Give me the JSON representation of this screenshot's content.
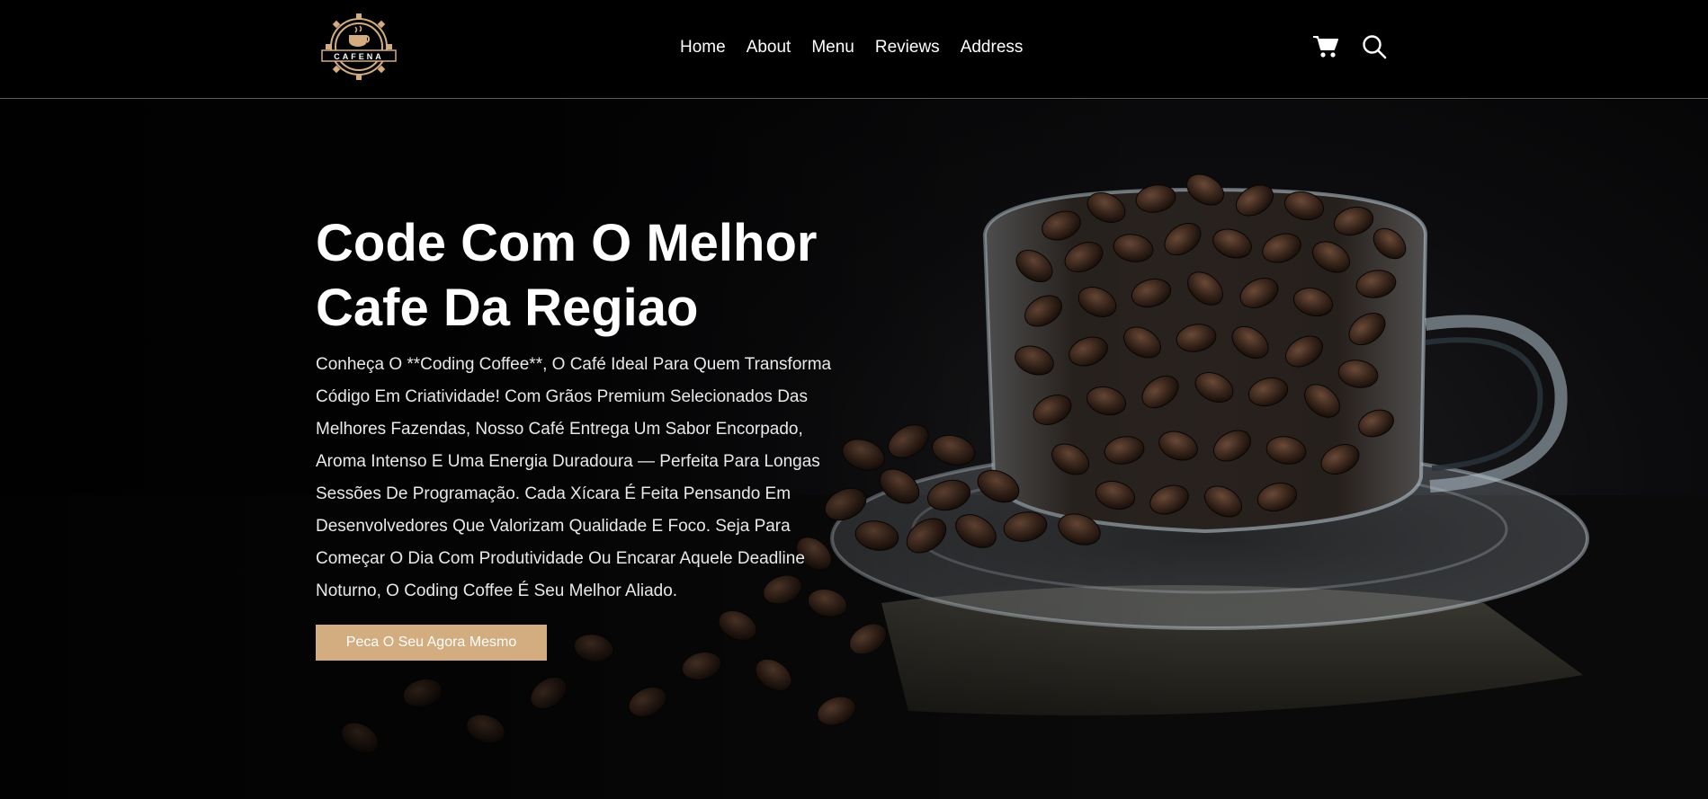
{
  "brand": {
    "logo_text": "CAFENA"
  },
  "nav": {
    "items": [
      "Home",
      "About",
      "Menu",
      "Reviews",
      "Address"
    ]
  },
  "header_icons": [
    "cart-icon",
    "search-icon"
  ],
  "hero": {
    "title_line1": "Code Com O Melhor",
    "title_line2": "Cafe Da Regiao",
    "description": "Conheça O **Coding Coffee**, O Café Ideal Para Quem Transforma Código Em Criatividade! Com Grãos Premium Selecionados Das Melhores Fazendas, Nosso Café Entrega Um Sabor Encorpado, Aroma Intenso E Uma Energia Duradoura — Perfeita Para Longas Sessões De Programação. Cada Xícara É Feita Pensando Em Desenvolvedores Que Valorizam Qualidade E Foco. Seja Para Começar O Dia Com Produtividade Ou Encarar Aquele Deadline Noturno, O Coding Coffee É Seu Melhor Aliado.",
    "cta_label": "Peca O Seu Agora Mesmo"
  },
  "colors": {
    "accent": "#d3ad7f",
    "background": "#000000",
    "text": "#ffffff"
  }
}
